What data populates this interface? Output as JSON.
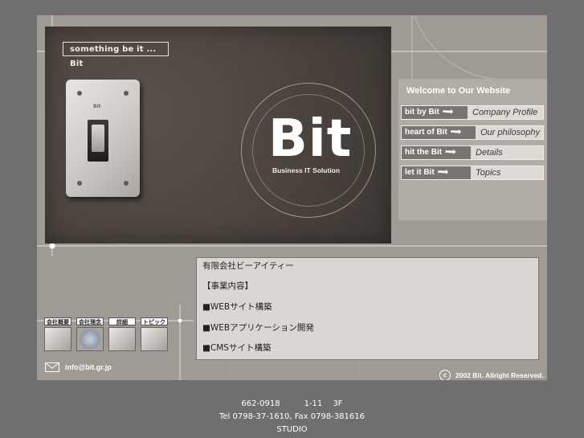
{
  "hero": {
    "tagline": "something be it ... Bit",
    "switch_brand": "Bit",
    "logo": "Bit",
    "logo_subtitle": "Business IT Solution"
  },
  "welcome": {
    "title": "Welcome to Our Website",
    "nav": [
      {
        "label": "bit by Bit",
        "arrow": "••➡",
        "link": "Company Profile"
      },
      {
        "label": "heart of Bit",
        "arrow": "••➡",
        "link": "Our philosophy"
      },
      {
        "label": "hit the Bit",
        "arrow": "••➡",
        "link": "Details"
      },
      {
        "label": "let it Bit",
        "arrow": "••➡",
        "link": "Topics"
      }
    ]
  },
  "content": {
    "lines": [
      "有限会社ビーアイティー",
      "【事業内容】",
      "■WEBサイト構築",
      "■WEBアプリケーション開発",
      "■CMSサイト構築"
    ]
  },
  "icons": [
    {
      "label": "会社概要",
      "icon": "switch-icon"
    },
    {
      "label": "会社理念",
      "icon": "globe-icon"
    },
    {
      "label": "詳細",
      "icon": "pin-icon"
    },
    {
      "label": "トピックス",
      "icon": "pushpin-icon"
    }
  ],
  "email": "info@bit.gr.jp",
  "copyright": "2002 Bit. Allright Reserved.",
  "copyright_symbol": "c",
  "footer": {
    "line1": "662-0918　　　1-11　 3F",
    "line2": "Tel 0798-37-1610, Fax 0798-381616",
    "line3": "STUDIO"
  },
  "colors": {
    "page_bg": "#6f6f6f",
    "panel_bg": "#a09a94",
    "nav_dark": "#7a7470",
    "nav_light": "#dedad6"
  }
}
